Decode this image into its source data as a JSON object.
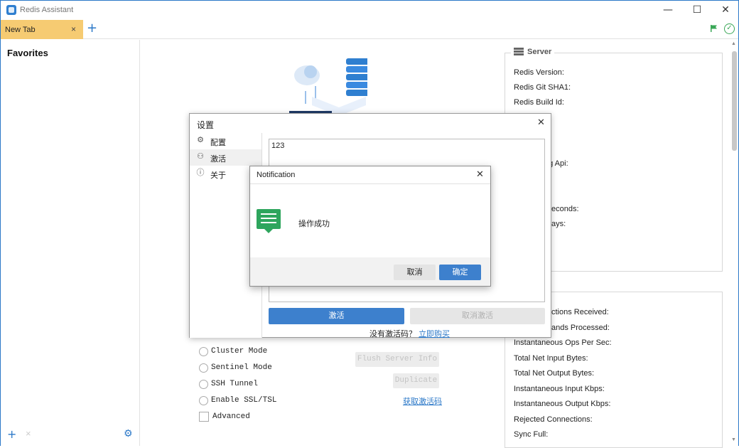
{
  "app": {
    "title": "Redis Assistant"
  },
  "window_controls": {
    "minimize": "—",
    "maximize": "☐",
    "close": "✕"
  },
  "tabs": [
    {
      "label": "New Tab",
      "close": "×"
    }
  ],
  "tab_add": "+",
  "status": {
    "check": "✓"
  },
  "sidebar": {
    "title": "Favorites",
    "add": "+",
    "remove": "×",
    "settings": "⚙"
  },
  "connection": {
    "options": [
      {
        "label": "Cluster Mode",
        "type": "radio"
      },
      {
        "label": "Sentinel Mode",
        "type": "radio"
      },
      {
        "label": "SSH Tunnel",
        "type": "radio"
      },
      {
        "label": "Enable SSL/TSL",
        "type": "radio"
      },
      {
        "label": "Advanced",
        "type": "checkbox"
      }
    ],
    "flush_button": "Flush Server Info",
    "duplicate_button": "Duplicate",
    "activation_link": "获取激活码"
  },
  "server_panel": {
    "title": "Server",
    "fields": [
      "Redis Version:",
      "Redis Git SHA1:",
      "Redis Build Id:",
      "",
      "",
      "ng Api:",
      "",
      "",
      "econds:",
      "ays:"
    ]
  },
  "stats_panel": {
    "fields": [
      "ctions Received:",
      "ands Processed:",
      "Instantaneous Ops Per Sec:",
      "Total Net Input Bytes:",
      "Total Net Output Bytes:",
      "Instantaneous Input Kbps:",
      "Instantaneous Output Kbps:",
      "Rejected Connections:",
      "Sync Full:"
    ]
  },
  "settings_dialog": {
    "title": "设置",
    "close": "✕",
    "nav": [
      {
        "label": "配置",
        "icon": "gear-icon",
        "glyph": "⚙"
      },
      {
        "label": "激活",
        "icon": "user-icon",
        "glyph": "⚇"
      },
      {
        "label": "关于",
        "icon": "info-icon",
        "glyph": "ⓘ"
      }
    ],
    "activation_key": "123",
    "activate_button": "激活",
    "deactivate_button": "取消激活",
    "no_code_text": "没有激活码？",
    "buy_link": "立即购买"
  },
  "notification": {
    "title": "Notification",
    "close": "✕",
    "message": "操作成功",
    "cancel_button": "取消",
    "ok_button": "确定",
    "icon": "message-icon"
  },
  "colors": {
    "accent": "#3d80cd",
    "tab_active": "#f6cb72",
    "success": "#2ea55d"
  }
}
